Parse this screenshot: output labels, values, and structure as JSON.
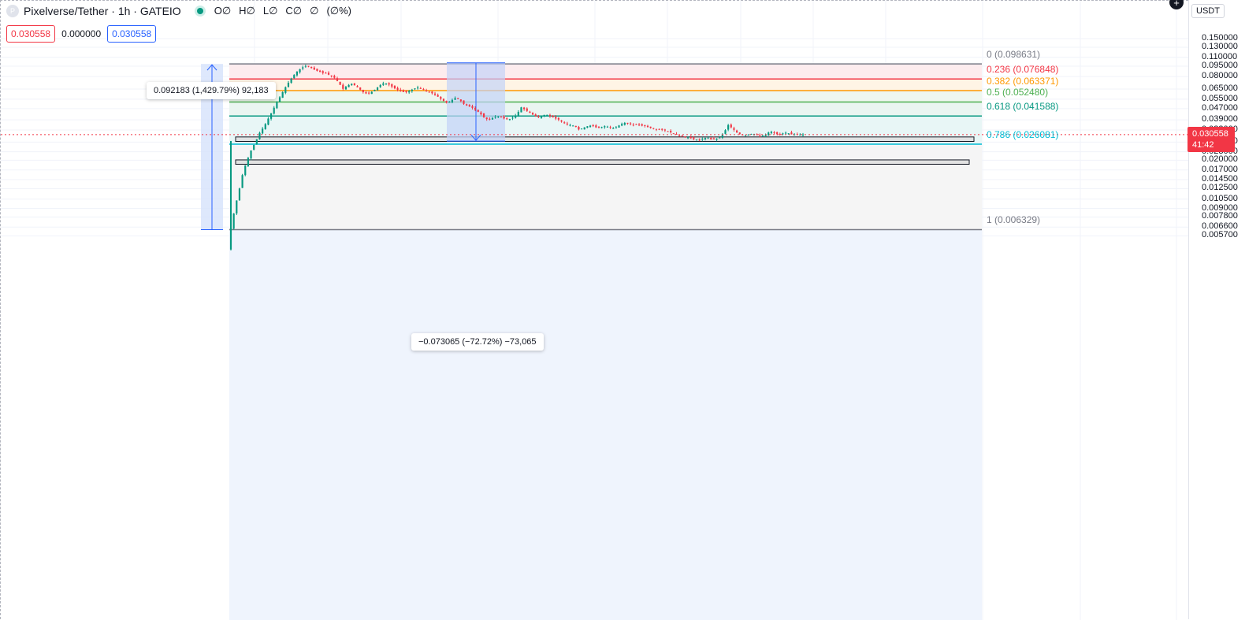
{
  "header": {
    "symbol_icon": "P",
    "title": "Pixelverse/Tether · 1h · GATEIO",
    "status_dot_color": "#089981",
    "ohlc": [
      "O∅",
      "H∅",
      "L∅",
      "C∅",
      "∅",
      "(∅%)"
    ],
    "bid": "0.030558",
    "spread": "0.000000",
    "ask": "0.030558"
  },
  "axis": {
    "unit": "USDT",
    "ticks": [
      "0.150000",
      "0.130000",
      "0.110000",
      "0.095000",
      "0.080000",
      "0.065000",
      "0.055000",
      "0.047000",
      "0.039000",
      "0.033000",
      "0.027000",
      "0.023000",
      "0.020000",
      "0.017000",
      "0.014500",
      "0.012500",
      "0.010500",
      "0.009000",
      "0.007800",
      "0.006600",
      "0.005700"
    ],
    "last_price": "0.030558",
    "countdown": "41:42"
  },
  "measures": {
    "up_label": "0.092183 (1,429.79%) 92,183",
    "down_label": "−0.073065 (−72.72%) −73,065"
  },
  "fib": {
    "levels": [
      {
        "label": "0 (0.098631)",
        "color": "#787b86",
        "price": 0.098631
      },
      {
        "label": "0.236 (0.076848)",
        "color": "#f23645",
        "price": 0.076848
      },
      {
        "label": "0.382 (0.063371)",
        "color": "#ff9800",
        "price": 0.063371
      },
      {
        "label": "0.5 (0.052480)",
        "color": "#4caf50",
        "price": 0.05248
      },
      {
        "label": "0.618 (0.041588)",
        "color": "#089981",
        "price": 0.041588
      },
      {
        "label": "0.786 (0.026081)",
        "color": "#00bcd4",
        "price": 0.026081
      },
      {
        "label": "1 (0.006329)",
        "color": "#787b86",
        "price": 0.006329
      }
    ]
  },
  "chart_data": {
    "type": "candlestick",
    "title": "Pixelverse/Tether · 1h · GATEIO",
    "ylabel": "USDT",
    "y_scale": "log",
    "ylim": [
      0.0053,
      0.165
    ],
    "last_price": 0.030558,
    "colors": {
      "up": "#089981",
      "down": "#f23645"
    },
    "zones": [
      {
        "name": "support-zone-1",
        "low": 0.0273,
        "high": 0.0294
      },
      {
        "name": "support-zone-2",
        "low": 0.0187,
        "high": 0.0201
      }
    ],
    "path": [
      0.0065,
      0.0092,
      0.0122,
      0.0168,
      0.0202,
      0.0241,
      0.0272,
      0.0318,
      0.0349,
      0.0398,
      0.0452,
      0.0517,
      0.0582,
      0.0658,
      0.0732,
      0.0805,
      0.0872,
      0.0921,
      0.0954,
      0.0938,
      0.0901,
      0.0874,
      0.0851,
      0.0843,
      0.0812,
      0.0784,
      0.0723,
      0.0651,
      0.0684,
      0.0712,
      0.0688,
      0.0652,
      0.0614,
      0.0598,
      0.0621,
      0.0653,
      0.0694,
      0.0721,
      0.0705,
      0.0672,
      0.0646,
      0.0631,
      0.0612,
      0.0628,
      0.0651,
      0.0668,
      0.0654,
      0.0632,
      0.0618,
      0.0597,
      0.0572,
      0.0541,
      0.0518,
      0.0532,
      0.0561,
      0.0553,
      0.0512,
      0.0493,
      0.0482,
      0.0461,
      0.0438,
      0.0408,
      0.0391,
      0.0401,
      0.0413,
      0.0412,
      0.0398,
      0.0392,
      0.0405,
      0.0428,
      0.0481,
      0.0462,
      0.0441,
      0.0423,
      0.0405,
      0.0418,
      0.0428,
      0.0415,
      0.0402,
      0.0393,
      0.0375,
      0.0362,
      0.0358,
      0.0352,
      0.0331,
      0.0342,
      0.0351,
      0.0356,
      0.0345,
      0.0341,
      0.0352,
      0.0348,
      0.0338,
      0.0345,
      0.0362,
      0.0371,
      0.0368,
      0.0359,
      0.0363,
      0.0355,
      0.0352,
      0.0343,
      0.0338,
      0.0332,
      0.0331,
      0.0326,
      0.0318,
      0.0309,
      0.0301,
      0.0296,
      0.0293,
      0.0288,
      0.0282,
      0.0279,
      0.0288,
      0.0292,
      0.0281,
      0.0284,
      0.0292,
      0.0318,
      0.0359,
      0.0338,
      0.0318,
      0.0305,
      0.0301,
      0.0306,
      0.0311,
      0.0302,
      0.0299,
      0.0303,
      0.0323,
      0.0315,
      0.0306,
      0.0311,
      0.0316,
      0.0309,
      0.0306,
      0.0305,
      0.0306
    ]
  }
}
